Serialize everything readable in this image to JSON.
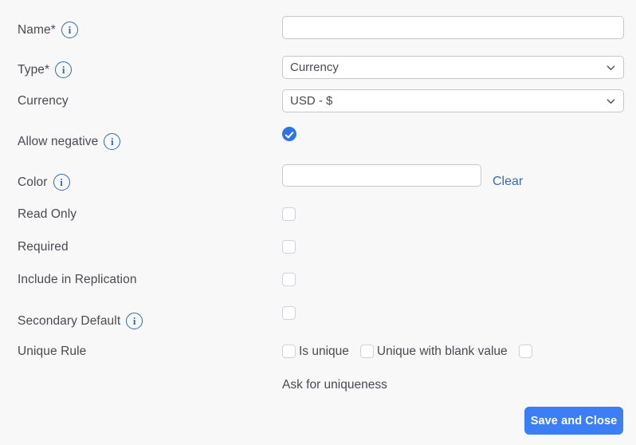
{
  "form": {
    "rows": [
      {
        "key": "name",
        "label": "Name*",
        "has_info": true,
        "info_glyph": "i",
        "control": "text",
        "value": "",
        "placeholder": ""
      },
      {
        "key": "type",
        "label": "Type*",
        "has_info": true,
        "info_glyph": "i",
        "control": "select",
        "value": "Currency"
      },
      {
        "key": "currency",
        "label": "Currency",
        "has_info": false,
        "control": "select",
        "value": "USD - $"
      },
      {
        "key": "allow_negative",
        "label": "Allow negative",
        "has_info": true,
        "info_glyph": "i",
        "control": "checkbox",
        "checked": true
      },
      {
        "key": "color",
        "label": "Color",
        "has_info": true,
        "info_glyph": "i",
        "control": "color",
        "value": "",
        "clear_label": "Clear"
      },
      {
        "key": "read_only",
        "label": "Read Only",
        "has_info": false,
        "control": "checkbox",
        "checked": false
      },
      {
        "key": "required",
        "label": "Required",
        "has_info": false,
        "control": "checkbox",
        "checked": false
      },
      {
        "key": "include_in_replication",
        "label": "Include in Replication",
        "has_info": false,
        "control": "checkbox",
        "checked": false
      },
      {
        "key": "secondary_default",
        "label": "Secondary Default",
        "has_info": true,
        "info_glyph": "i",
        "control": "checkbox",
        "checked": false
      },
      {
        "key": "unique_rule",
        "label": "Unique Rule",
        "has_info": false,
        "control": "checkbox-group"
      }
    ],
    "unique_rule": {
      "options": [
        {
          "label": "Is unique",
          "checked": false
        },
        {
          "label": "Unique with blank value",
          "checked": false
        },
        {
          "label": "Ask for uniqueness",
          "checked": false
        }
      ]
    },
    "save_button": "Save and Close"
  },
  "colors": {
    "page_background": "#f8f8f9",
    "label_text": "#4a4a52",
    "info_icon": "#2d6ca8",
    "link": "#3a6ea5",
    "checkbox_border": "#cfd2e1",
    "checkbox_checked": "#2f73e8",
    "input_border": "#c8c8cc",
    "primary_button": "#3b7ef6"
  }
}
